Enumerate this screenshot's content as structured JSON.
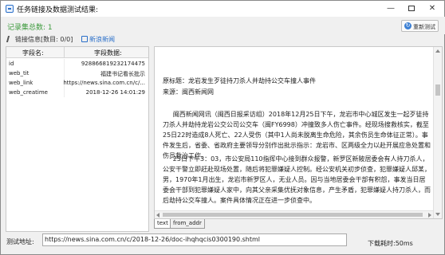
{
  "window": {
    "title": "任务链接及数据测试结果:",
    "controls": [
      "minimize",
      "maximize",
      "close"
    ]
  },
  "summary": {
    "record_count": "记录集总数: 1",
    "refresh_label": "重新测试",
    "refresh_icon": "refresh-icon"
  },
  "tabs": {
    "link_info": "链接信息[数目: 0/0]",
    "news": "新浪新闻"
  },
  "grid": {
    "headers": [
      "字段名:",
      "字段数据:"
    ],
    "rows": [
      {
        "key": "id",
        "value": "928866819232174475"
      },
      {
        "key": "web_tit",
        "value": "福建书记看长批示"
      },
      {
        "key": "web_link",
        "value": "https://news.sina.com.cn/c/..."
      },
      {
        "key": "web_creatime",
        "value": "2018-12-26 14:01:29"
      }
    ]
  },
  "content": {
    "paragraphs": [
      "原标题：龙岩发生歹徒持刀杀人并劫持公交车撞人事件",
      "来源：闽西新闻网",
      "闽西新闻网讯（闽西日报采访组）2018年12月25日下午，龙岩市中心城区发生一起歹徒持刀杀人并劫持龙岩公交公司公交车（闽FY6998）冲撞致多人伤亡事件。经现场搜救核实，截至25日22时造成8人死亡、22人受伤（其中1人尚未脱离生命危险，其余伤员生命体征正常）。事件发生后，省委、省政府主要领导分别作出批示指示：龙岩市、区两级全力以赴开展应急处置和伤员救治工作。",
      "25日下午3：03，市公安局110指挥中心接到群众报警，新罗区新陂居委会有人持刀杀人，公安干警立即赶赴现场处置，随后将犯罪嫌疑人控制。经公安机关初步侦查，犯罪嫌疑人邱某，男，1970年1月出生，龙岩市新罗区人，无业人员。因与当地居委会干部有积怨，事发当日居委会干部到犯罪嫌疑人家中，向其父亲采集优抚对象信息，产生矛盾，犯罪嫌疑人持刀杀人，而后劫持公交车撞人。案件具体情况正在进一步侦查中。"
    ],
    "bottom_tabs": [
      "text",
      "from_addr"
    ]
  },
  "footer": {
    "url_label": "测试地址:",
    "url_value": "https://news.sina.com.cn/c/2018-12-26/doc-ihqhqcis0300190.shtml",
    "timing": "下载耗时:50ms"
  }
}
